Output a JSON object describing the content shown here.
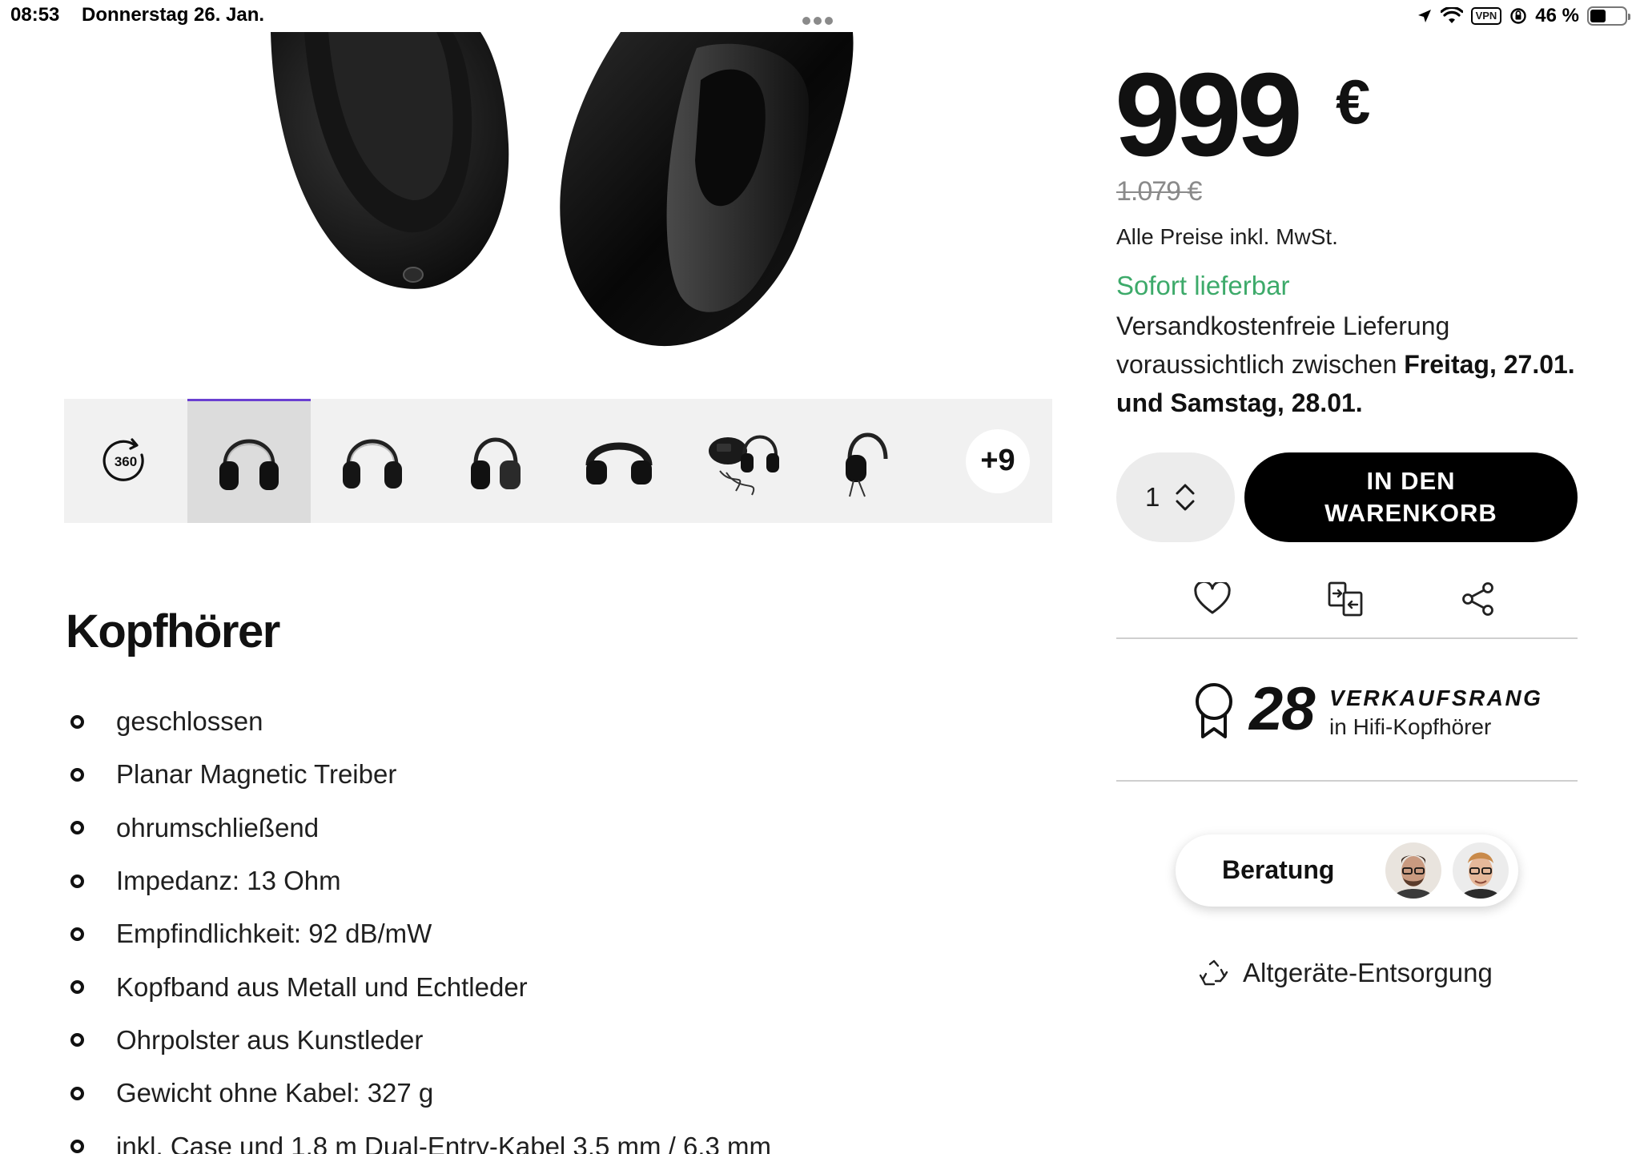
{
  "status_bar": {
    "time": "08:53",
    "date": "Donnerstag 26. Jan.",
    "vpn": "VPN",
    "battery_percent": "46 %",
    "battery_level": 0.46
  },
  "gallery": {
    "more_count": "+9",
    "thumbnails": [
      "360-view",
      "headphone-front",
      "headphone-front-2",
      "headphone-side",
      "headphone-top",
      "headphone-case-accessories",
      "headphone-cable"
    ]
  },
  "product": {
    "category_title": "Kopfhörer",
    "features": [
      "geschlossen",
      "Planar Magnetic Treiber",
      "ohrumschließend",
      "Impedanz: 13 Ohm",
      "Empfindlichkeit: 92 dB/mW",
      "Kopfband aus Metall und Echtleder",
      "Ohrpolster aus Kunstleder",
      "Gewicht ohne Kabel: 327 g",
      "inkl. Case und 1,8 m Dual-Entry-Kabel 3,5 mm / 6,3 mm"
    ]
  },
  "purchase": {
    "price": "999",
    "currency": "€",
    "old_price": "1.079 €",
    "vat_note": "Alle Preise inkl. MwSt.",
    "availability": "Sofort lieferbar",
    "delivery_line1": "Versandkostenfreie Lieferung",
    "delivery_line2_prefix": "voraussichtlich zwischen ",
    "delivery_date1": "Freitag, 27.01.",
    "delivery_date2": "und Samstag, 28.01.",
    "quantity": "1",
    "cart_button": "IN DEN WARENKORB",
    "availability_color": "#3daa6a"
  },
  "rank": {
    "number": "28",
    "label": "VERKAUFSRANG",
    "category": "in Hifi-Kopfhörer"
  },
  "advice": {
    "label": "Beratung"
  },
  "disposal": {
    "label": "Altgeräte-Entsorgung"
  }
}
